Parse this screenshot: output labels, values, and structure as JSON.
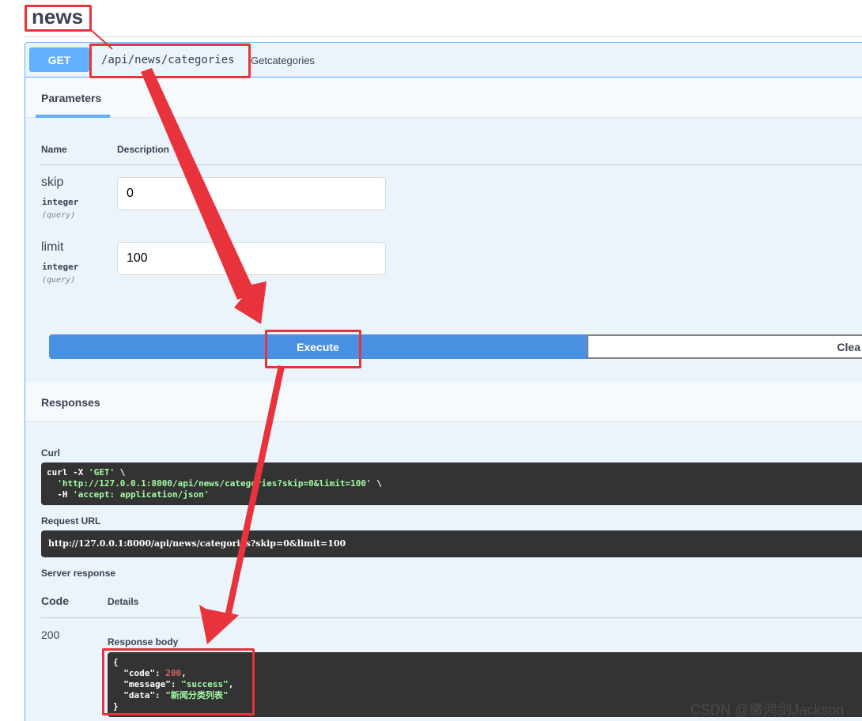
{
  "tag": {
    "title": "news"
  },
  "endpoint": {
    "method": "GET",
    "path": "/api/news/categories",
    "summary": "Getcategories"
  },
  "parameters": {
    "tab_label": "Parameters",
    "col_name": "Name",
    "col_description": "Description",
    "items": [
      {
        "name": "skip",
        "type": "integer",
        "in": "(query)",
        "value": "0"
      },
      {
        "name": "limit",
        "type": "integer",
        "in": "(query)",
        "value": "100"
      }
    ]
  },
  "actions": {
    "execute_label": "Execute",
    "clear_label": "Clea"
  },
  "responses": {
    "title": "Responses",
    "curl_label": "Curl",
    "curl_cmd": "curl -X ",
    "curl_method": "'GET'",
    "curl_cont1": " \\",
    "curl_url": "'http://127.0.0.1:8000/api/news/categories?skip=0&limit=100'",
    "curl_cont2": " \\",
    "curl_h": "  -H ",
    "curl_header": "'accept: application/json'",
    "request_url_label": "Request URL",
    "request_url": "http://127.0.0.1:8000/api/news/categories?skip=0&limit=100",
    "server_response_label": "Server response",
    "col_code": "Code",
    "col_details": "Details",
    "status_code": "200",
    "body_label": "Response body",
    "body": {
      "open": "{",
      "code_key": "\"code\"",
      "code_val": "200",
      "message_key": "\"message\"",
      "message_val": "\"success\"",
      "data_key": "\"data\"",
      "data_val": "\"新闻分类列表\"",
      "close": "}"
    }
  },
  "watermark": "CSDN @缴鸿剑Jackson",
  "colors": {
    "get": "#61affe",
    "execute": "#4990e2",
    "highlight": "#e8333c"
  }
}
